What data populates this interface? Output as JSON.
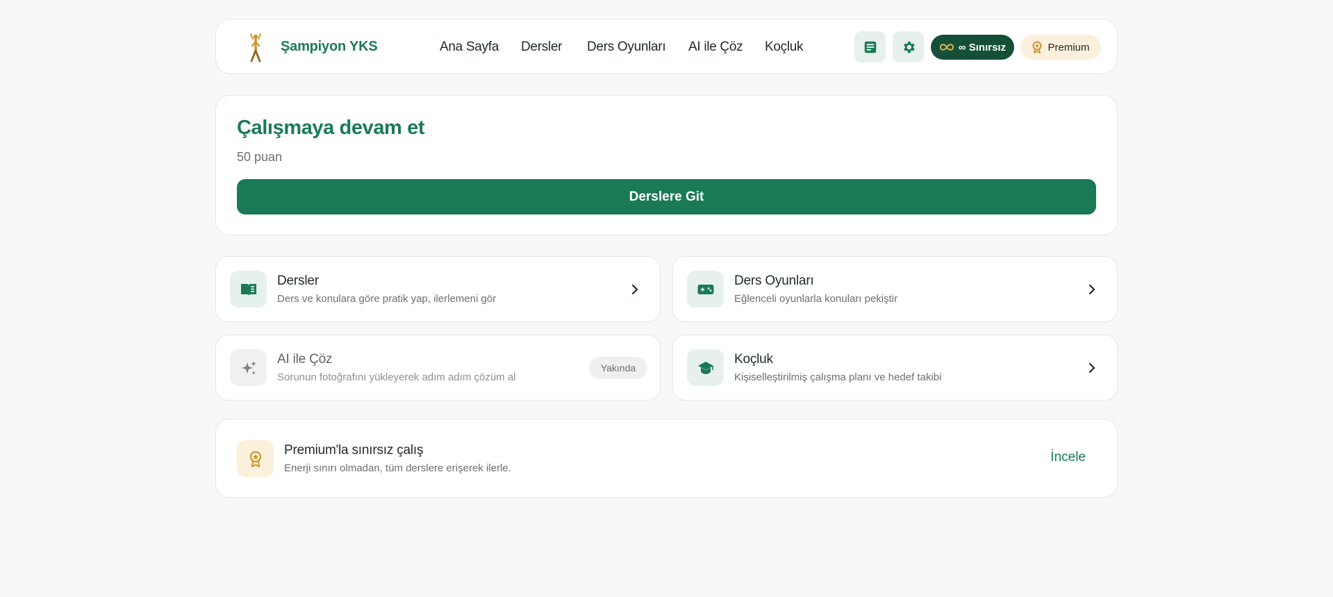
{
  "header": {
    "brand": "Şampiyon YKS",
    "nav": [
      "Ana Sayfa",
      "Dersler",
      "Ders Oyunları",
      "AI ile Çöz",
      "Koçluk"
    ],
    "energy_label": "∞ Sınırsız",
    "premium_label": "Premium"
  },
  "continue_card": {
    "title": "Çalışmaya devam et",
    "points": "50 puan",
    "button": "Derslere Git"
  },
  "features": [
    {
      "title": "Dersler",
      "desc": "Ders ve konulara göre pratik yap, ilerlemeni gör",
      "icon": "book-icon"
    },
    {
      "title": "Ders Oyunları",
      "desc": "Eğlenceli oyunlarla konuları pekiştir",
      "icon": "gamepad-icon"
    },
    {
      "title": "AI ile Çöz",
      "desc": "Sorunun fotoğrafını yükleyerek adım adım çözüm al",
      "icon": "sparkles-icon",
      "badge": "Yakında"
    },
    {
      "title": "Koçluk",
      "desc": "Kişiselleştirilmiş çalışma planı ve hedef takibi",
      "icon": "graduation-cap-icon"
    }
  ],
  "premium_card": {
    "title": "Premium'la sınırsız çalış",
    "desc": "Enerji sınırı olmadan, tüm derslere erişerek ilerle.",
    "link": "İncele"
  },
  "colors": {
    "primary": "#1a7a56",
    "dark_green": "#154f37",
    "gold": "#c9952f",
    "cream": "#fbf0dc",
    "background": "#f8f8f7"
  }
}
